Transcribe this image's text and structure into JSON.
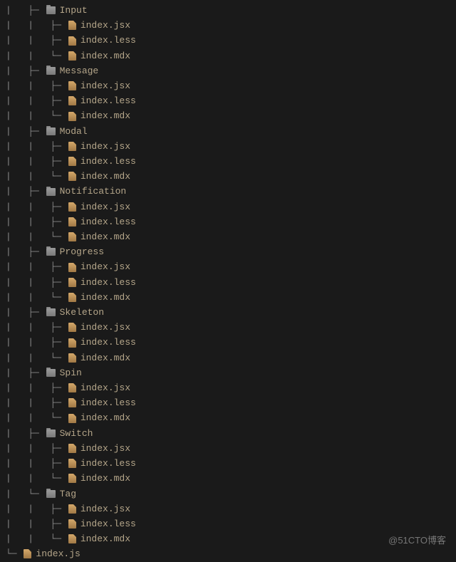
{
  "watermark": "@51CTO博客",
  "tree": [
    {
      "prefix": "|   ├─ ",
      "type": "folder",
      "name": "Input"
    },
    {
      "prefix": "|   |   ├─ ",
      "type": "file",
      "name": "index.jsx"
    },
    {
      "prefix": "|   |   ├─ ",
      "type": "file",
      "name": "index.less"
    },
    {
      "prefix": "|   |   └─ ",
      "type": "file",
      "name": "index.mdx"
    },
    {
      "prefix": "|   ├─ ",
      "type": "folder",
      "name": "Message"
    },
    {
      "prefix": "|   |   ├─ ",
      "type": "file",
      "name": "index.jsx"
    },
    {
      "prefix": "|   |   ├─ ",
      "type": "file",
      "name": "index.less"
    },
    {
      "prefix": "|   |   └─ ",
      "type": "file",
      "name": "index.mdx"
    },
    {
      "prefix": "|   ├─ ",
      "type": "folder",
      "name": "Modal"
    },
    {
      "prefix": "|   |   ├─ ",
      "type": "file",
      "name": "index.jsx"
    },
    {
      "prefix": "|   |   ├─ ",
      "type": "file",
      "name": "index.less"
    },
    {
      "prefix": "|   |   └─ ",
      "type": "file",
      "name": "index.mdx"
    },
    {
      "prefix": "|   ├─ ",
      "type": "folder",
      "name": "Notification"
    },
    {
      "prefix": "|   |   ├─ ",
      "type": "file",
      "name": "index.jsx"
    },
    {
      "prefix": "|   |   ├─ ",
      "type": "file",
      "name": "index.less"
    },
    {
      "prefix": "|   |   └─ ",
      "type": "file",
      "name": "index.mdx"
    },
    {
      "prefix": "|   ├─ ",
      "type": "folder",
      "name": "Progress"
    },
    {
      "prefix": "|   |   ├─ ",
      "type": "file",
      "name": "index.jsx"
    },
    {
      "prefix": "|   |   ├─ ",
      "type": "file",
      "name": "index.less"
    },
    {
      "prefix": "|   |   └─ ",
      "type": "file",
      "name": "index.mdx"
    },
    {
      "prefix": "|   ├─ ",
      "type": "folder",
      "name": "Skeleton"
    },
    {
      "prefix": "|   |   ├─ ",
      "type": "file",
      "name": "index.jsx"
    },
    {
      "prefix": "|   |   ├─ ",
      "type": "file",
      "name": "index.less"
    },
    {
      "prefix": "|   |   └─ ",
      "type": "file",
      "name": "index.mdx"
    },
    {
      "prefix": "|   ├─ ",
      "type": "folder",
      "name": "Spin"
    },
    {
      "prefix": "|   |   ├─ ",
      "type": "file",
      "name": "index.jsx"
    },
    {
      "prefix": "|   |   ├─ ",
      "type": "file",
      "name": "index.less"
    },
    {
      "prefix": "|   |   └─ ",
      "type": "file",
      "name": "index.mdx"
    },
    {
      "prefix": "|   ├─ ",
      "type": "folder",
      "name": "Switch"
    },
    {
      "prefix": "|   |   ├─ ",
      "type": "file",
      "name": "index.jsx"
    },
    {
      "prefix": "|   |   ├─ ",
      "type": "file",
      "name": "index.less"
    },
    {
      "prefix": "|   |   └─ ",
      "type": "file",
      "name": "index.mdx"
    },
    {
      "prefix": "|   └─ ",
      "type": "folder",
      "name": "Tag"
    },
    {
      "prefix": "|   |   ├─ ",
      "type": "file",
      "name": "index.jsx"
    },
    {
      "prefix": "|   |   ├─ ",
      "type": "file",
      "name": "index.less"
    },
    {
      "prefix": "|   |   └─ ",
      "type": "file",
      "name": "index.mdx"
    },
    {
      "prefix": "└─ ",
      "type": "file",
      "name": "index.js"
    }
  ]
}
